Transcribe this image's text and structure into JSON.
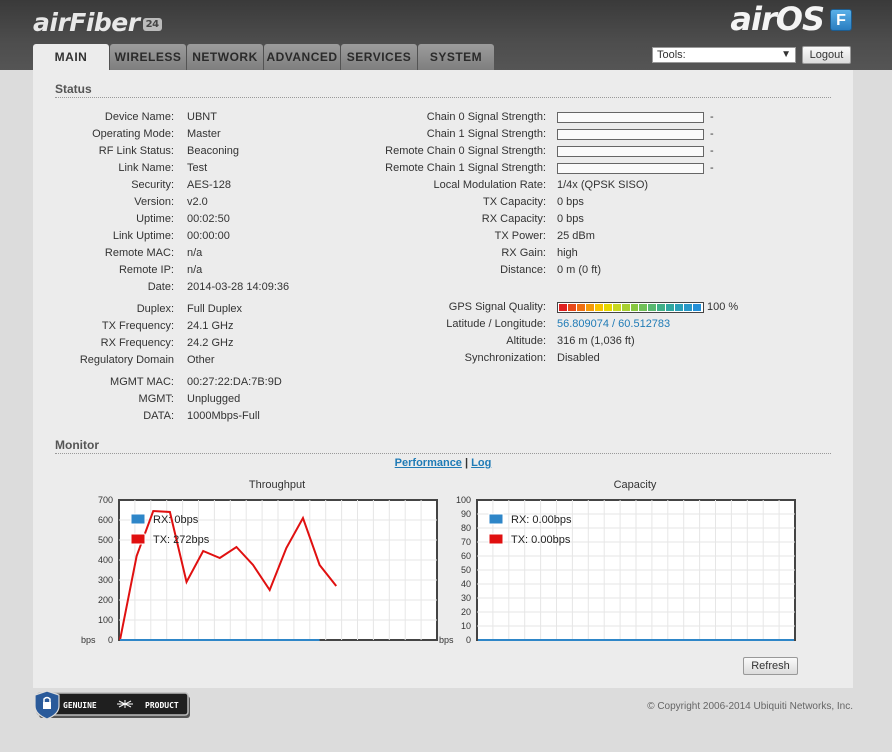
{
  "header": {
    "product": "airFiber",
    "product_badge": "24",
    "os": "airOS",
    "os_badge": "F"
  },
  "tabs": [
    {
      "label": "MAIN",
      "active": true
    },
    {
      "label": "WIRELESS"
    },
    {
      "label": "NETWORK"
    },
    {
      "label": "ADVANCED"
    },
    {
      "label": "SERVICES"
    },
    {
      "label": "SYSTEM"
    }
  ],
  "toolbar": {
    "tools_value": "Tools:",
    "logout_label": "Logout"
  },
  "status": {
    "title": "Status",
    "left": [
      {
        "label": "Device Name:",
        "value": "UBNT"
      },
      {
        "label": "Operating Mode:",
        "value": "Master"
      },
      {
        "label": "RF Link Status:",
        "value": "Beaconing"
      },
      {
        "label": "Link Name:",
        "value": "Test"
      },
      {
        "label": "Security:",
        "value": "AES-128"
      },
      {
        "label": "Version:",
        "value": "v2.0"
      },
      {
        "label": "Uptime:",
        "value": "00:02:50"
      },
      {
        "label": "Link Uptime:",
        "value": "00:00:00"
      },
      {
        "label": "Remote MAC:",
        "value": "n/a"
      },
      {
        "label": "Remote IP:",
        "value": "n/a"
      },
      {
        "label": "Date:",
        "value": "2014-03-28 14:09:36"
      }
    ],
    "left2": [
      {
        "label": "Duplex:",
        "value": "Full Duplex"
      },
      {
        "label": "TX Frequency:",
        "value": "24.1 GHz"
      },
      {
        "label": "RX Frequency:",
        "value": "24.2 GHz"
      },
      {
        "label": "Regulatory Domain",
        "value": "Other"
      }
    ],
    "left3": [
      {
        "label": "MGMT MAC:",
        "value": "00:27:22:DA:7B:9D"
      },
      {
        "label": "MGMT:",
        "value": "Unplugged"
      },
      {
        "label": "DATA:",
        "value": "1000Mbps-Full"
      }
    ],
    "signal": [
      {
        "label": "Chain 0 Signal Strength:",
        "value": "-"
      },
      {
        "label": "Chain 1 Signal Strength:",
        "value": "-"
      },
      {
        "label": "Remote Chain 0 Signal Strength:",
        "value": "-"
      },
      {
        "label": "Remote Chain 1 Signal Strength:",
        "value": "-"
      }
    ],
    "right": [
      {
        "label": "Local Modulation Rate:",
        "value": "1/4x (QPSK SISO)"
      },
      {
        "label": "TX Capacity:",
        "value": "0 bps"
      },
      {
        "label": "RX Capacity:",
        "value": "0 bps"
      },
      {
        "label": "TX Power:",
        "value": "25 dBm"
      },
      {
        "label": "RX Gain:",
        "value": "high"
      },
      {
        "label": "Distance:",
        "value": "0 m (0 ft)"
      }
    ],
    "gps": {
      "label": "GPS Signal Quality:",
      "value": "100 %",
      "fraction": 1.0,
      "colors": [
        "#e02020",
        "#e84818",
        "#f07010",
        "#f59a08",
        "#f8c400",
        "#e8d800",
        "#c8d820",
        "#a8d030",
        "#88c840",
        "#70c058",
        "#58b870",
        "#40b088",
        "#30a8a0",
        "#2aa0b8",
        "#2898c8",
        "#2290d8"
      ]
    },
    "right2": [
      {
        "label": "Latitude / Longitude:",
        "value": "56.809074 / 60.512783",
        "link": true
      },
      {
        "label": "Altitude:",
        "value": "316 m (1,036 ft)"
      },
      {
        "label": "Synchronization:",
        "value": "Disabled"
      }
    ]
  },
  "monitor": {
    "title": "Monitor",
    "link_performance": "Performance",
    "separator": "|",
    "link_log": "Log",
    "refresh_label": "Refresh"
  },
  "chart_data": [
    {
      "type": "line",
      "title": "Throughput",
      "ylabel": "bps",
      "ylim": [
        0,
        700
      ],
      "yticks": [
        0,
        100,
        200,
        300,
        400,
        500,
        600,
        700
      ],
      "grid": true,
      "legend_position": "top-left",
      "series": [
        {
          "name": "RX: 0bps",
          "color": "#2e86c8",
          "values": [
            0,
            0,
            0,
            0,
            0,
            0,
            0,
            0,
            0,
            0,
            0,
            0,
            0
          ]
        },
        {
          "name": "TX: 272bps",
          "color": "#e01010",
          "values": [
            0,
            420,
            645,
            640,
            290,
            445,
            410,
            465,
            375,
            250,
            460,
            610,
            375,
            270
          ]
        }
      ],
      "x": [
        0,
        1,
        2,
        3,
        4,
        5,
        6,
        7,
        8,
        9,
        10,
        11,
        12,
        13
      ]
    },
    {
      "type": "line",
      "title": "Capacity",
      "ylabel": "bps",
      "ylim": [
        0,
        100
      ],
      "yticks": [
        0,
        10,
        20,
        30,
        40,
        50,
        60,
        70,
        80,
        90,
        100
      ],
      "grid": true,
      "legend_position": "top-left",
      "series": [
        {
          "name": "RX: 0.00bps",
          "color": "#2e86c8",
          "values": [
            0,
            0
          ]
        },
        {
          "name": "TX: 0.00bps",
          "color": "#e01010",
          "values": [
            0,
            0
          ]
        }
      ]
    }
  ],
  "footer": {
    "badge_text": "GENUINE PRODUCT",
    "copyright": "© Copyright 2006-2014 Ubiquiti Networks, Inc."
  }
}
